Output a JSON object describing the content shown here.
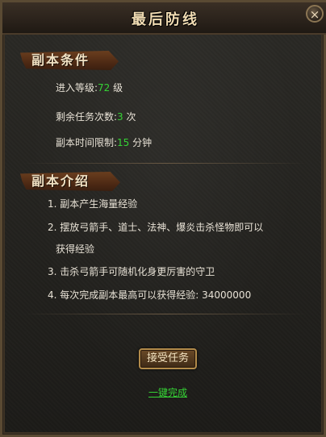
{
  "window": {
    "title": "最后防线",
    "close_label": "×"
  },
  "conditions": {
    "header": "副本条件",
    "level_label": "进入等级:",
    "level_value": "72",
    "level_unit": " 级",
    "remaining_label": "剩余任务次数:",
    "remaining_value": "3",
    "remaining_unit": " 次",
    "time_label": "副本时间限制:",
    "time_value": "15",
    "time_unit": " 分钟"
  },
  "intro": {
    "header": "副本介绍",
    "items": [
      "1. 副本产生海量经验",
      "2. 摆放弓箭手、道士、法神、爆炎击杀怪物即可以",
      "获得经验",
      "3. 击杀弓箭手可随机化身更厉害的守卫",
      "4. 每次完成副本最高可以获得经验: 34000000"
    ]
  },
  "actions": {
    "accept_label": "接受任务",
    "complete_label": "一键完成"
  }
}
